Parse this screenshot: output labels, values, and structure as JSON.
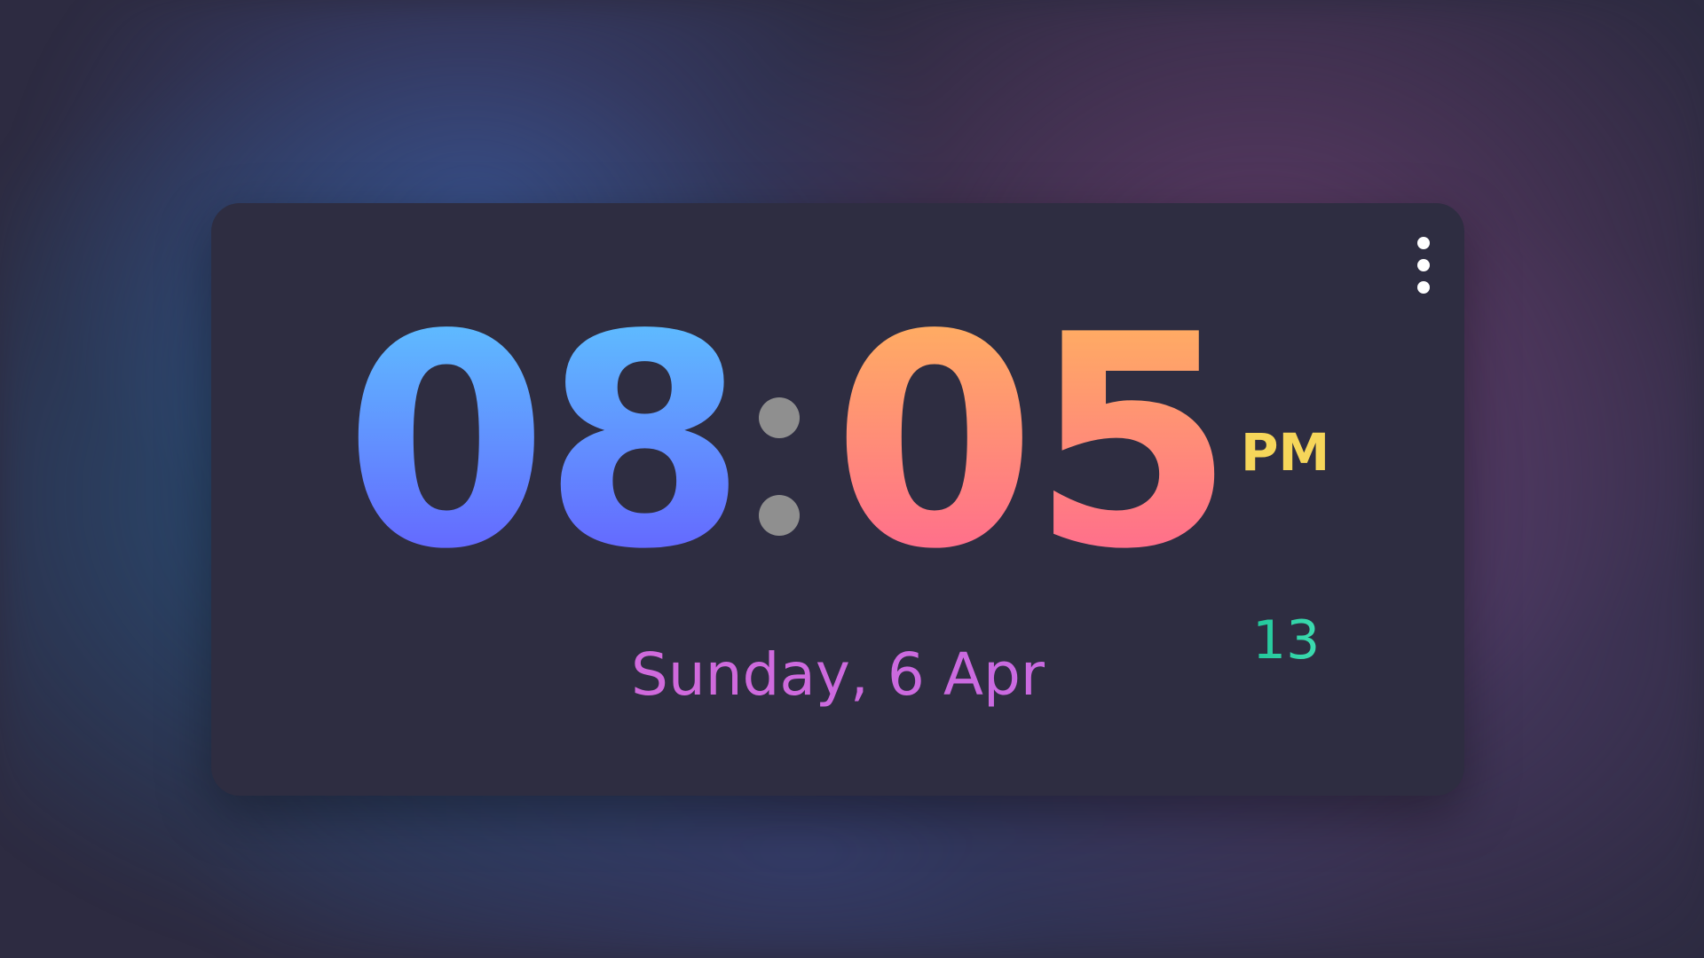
{
  "clock": {
    "hours": "08",
    "minutes": "05",
    "period": "PM",
    "seconds": "13",
    "date": "Sunday, 6 Apr"
  },
  "icons": {
    "menu": "more-vertical-icon"
  },
  "colors": {
    "background": "#2c2b41",
    "card": "#2e2d41",
    "hours_gradient": [
      "#5ec0ff",
      "#6560ff"
    ],
    "minutes_gradient": [
      "#ffb060",
      "#ff6890"
    ],
    "colon": "#8f8f8f",
    "period": "#f6d65a",
    "seconds": "#2fd3a6",
    "date": "#d06ade"
  }
}
